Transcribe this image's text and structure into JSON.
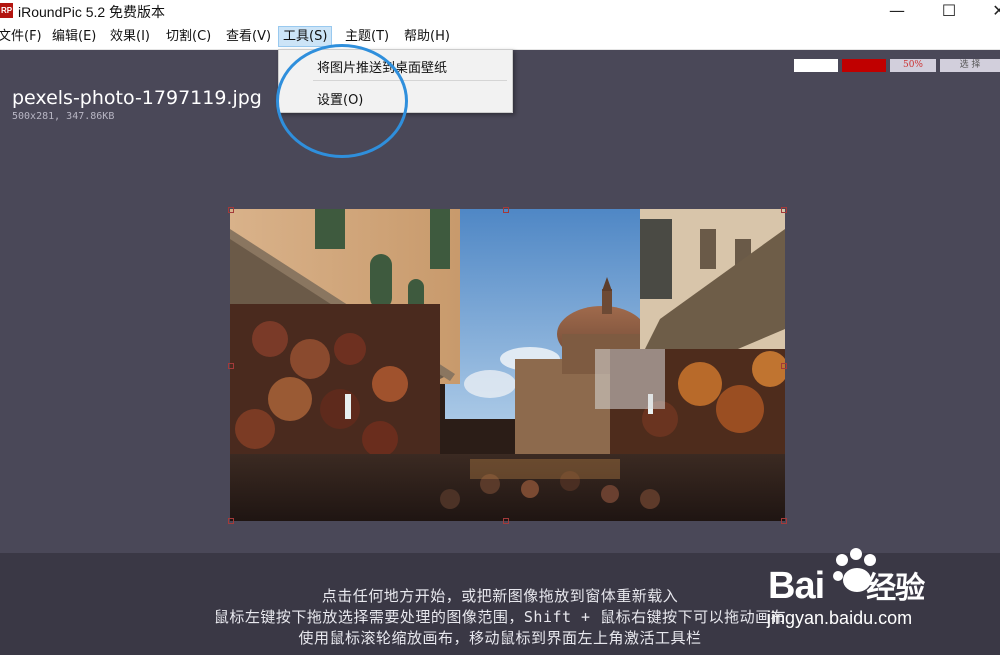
{
  "app": {
    "logo_text": "RP",
    "title": "iRoundPic 5.2 免费版本"
  },
  "window_controls": {
    "minimize": "—",
    "maximize": "☐",
    "close": "✕"
  },
  "menu": {
    "file": "文件(F)",
    "edit": "编辑(E)",
    "effect": "效果(I)",
    "cut": "切割(C)",
    "view": "查看(V)",
    "tools": "工具(S)",
    "theme": "主题(T)",
    "help": "帮助(H)"
  },
  "tools_menu": {
    "set_wallpaper": "将图片推送到桌面壁纸",
    "settings": "设置(O)"
  },
  "controls": {
    "zoom": "50%",
    "select": "选 择",
    "colors": {
      "swatch_white": "#ffffff",
      "swatch_red": "#c00000"
    }
  },
  "file": {
    "name": "pexels-photo-1797119.jpg",
    "meta": "500x281, 347.86KB"
  },
  "hints": {
    "line1": "点击任何地方开始，或把新图像拖放到窗体重新载入",
    "line2": "鼠标左键按下拖放选择需要处理的图像范围，Shift + 鼠标右键按下可以拖动画布",
    "line3": "使用鼠标滚轮缩放画布，移动鼠标到界面左上角激活工具栏"
  },
  "watermark": {
    "brand": "Bai",
    "brand_suffix": "经验",
    "url": "jingyan.baidu.com"
  },
  "colors": {
    "background": "#4a4858",
    "footer": "#3a3845",
    "highlight_ring": "#2f8fdc",
    "menu_active": "#cce4f7"
  }
}
